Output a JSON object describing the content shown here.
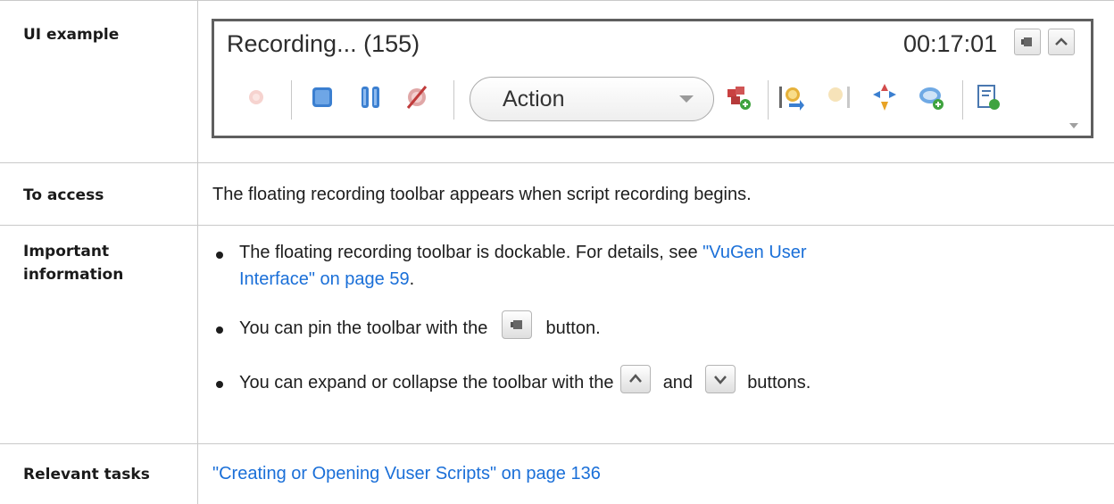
{
  "rows": {
    "ui_example": {
      "label": "UI example"
    },
    "to_access": {
      "label": "To access",
      "text": "The floating recording toolbar appears when script recording begins."
    },
    "important": {
      "label_line1": "Important",
      "label_line2": "information",
      "bullet1_prefix": "The floating recording toolbar is dockable. For details, see ",
      "bullet1_link_line1": "\"VuGen User",
      "bullet1_link_line2": "Interface\" on page 59",
      "bullet1_suffix": ".",
      "bullet2_prefix": "You can pin the toolbar with the",
      "bullet2_suffix": "button.",
      "bullet3_prefix": "You can expand or collapse the toolbar with the",
      "bullet3_middle": "and",
      "bullet3_suffix": "buttons."
    },
    "relevant_tasks": {
      "label": "Relevant tasks",
      "link": "\"Creating or Opening Vuser Scripts\" on page 136"
    }
  },
  "toolbar": {
    "title": "Recording... (155)",
    "time": "00:17:01",
    "action_label": "Action",
    "icons": [
      "record-icon",
      "stop-icon",
      "pause-icon",
      "cancel-recording-icon",
      "add-action-icon",
      "start-transaction-icon",
      "end-transaction-icon",
      "rendezvous-icon",
      "comment-icon",
      "insert-step-icon"
    ],
    "small_buttons": [
      "pin-icon",
      "collapse-icon"
    ]
  },
  "colors": {
    "link": "#1a6fd8",
    "grid": "#c9c9c9",
    "toolbar_border": "#5f5f5f"
  }
}
